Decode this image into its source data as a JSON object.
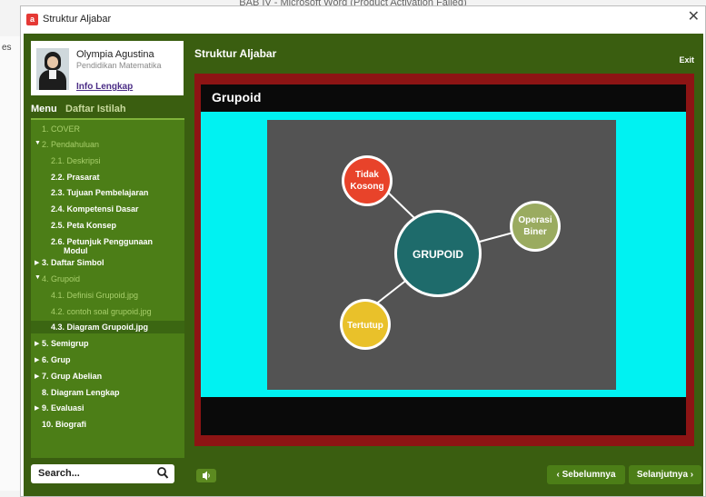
{
  "background_window": {
    "title": "BAB IV - Microsoft Word (Product Activation Failed)",
    "side_text": "es"
  },
  "window": {
    "title": "Struktur Aljabar",
    "icon": "presentation-app-icon",
    "close_icon": "close-icon"
  },
  "profile": {
    "name": "Olympia Agustina",
    "role": "Pendidikan Matematika",
    "link": "Info Lengkap"
  },
  "tabs": {
    "menu": "Menu",
    "glossary": "Daftar Istilah"
  },
  "menu": {
    "items": [
      {
        "label": "1. COVER",
        "arrow": ""
      },
      {
        "label": "2. Pendahuluan",
        "arrow": "▼"
      },
      {
        "label": "2.1. Deskripsi",
        "arrow": ""
      },
      {
        "label": "2.2. Prasarat",
        "arrow": ""
      },
      {
        "label": "2.3. Tujuan Pembelajaran",
        "arrow": ""
      },
      {
        "label": "2.4. Kompetensi Dasar",
        "arrow": ""
      },
      {
        "label": "2.5. Peta Konsep",
        "arrow": ""
      },
      {
        "label": "2.6. Petunjuk Penggunaan",
        "arrow": ""
      },
      {
        "label": "Modul",
        "arrow": ""
      },
      {
        "label": "3. Daftar Simbol",
        "arrow": "▶"
      },
      {
        "label": "4. Grupoid",
        "arrow": "▼"
      },
      {
        "label": "4.1. Definisi Grupoid.jpg",
        "arrow": ""
      },
      {
        "label": "4.2. contoh soal grupoid.jpg",
        "arrow": ""
      },
      {
        "label": "4.3. Diagram Grupoid.jpg",
        "arrow": ""
      },
      {
        "label": "5. Semigrup",
        "arrow": "▶"
      },
      {
        "label": "6. Grup",
        "arrow": "▶"
      },
      {
        "label": "7. Grup Abelian",
        "arrow": "▶"
      },
      {
        "label": "8. Diagram Lengkap",
        "arrow": ""
      },
      {
        "label": "9. Evaluasi",
        "arrow": "▶"
      },
      {
        "label": "10. Biografi",
        "arrow": ""
      }
    ]
  },
  "search": {
    "placeholder": "Search...",
    "icon": "search-icon"
  },
  "header": {
    "title": "Struktur Aljabar",
    "exit": "Exit"
  },
  "slide": {
    "title": "Grupoid",
    "diagram": {
      "center": {
        "label": "GRUPOID",
        "color": "#1e6b6b"
      },
      "nodes": [
        {
          "line1": "Tidak",
          "line2": "Kosong",
          "color": "#e8432a"
        },
        {
          "line1": "Operasi",
          "line2": "Biner",
          "color": "#9aab60"
        },
        {
          "line1": "Tertutup",
          "line2": "",
          "color": "#e9c12a"
        }
      ]
    }
  },
  "nav": {
    "prev": "‹ Sebelumnya",
    "next": "Selanjutnya ›",
    "volume_icon": "speaker-icon"
  },
  "colors": {
    "app_bg": "#3a5e10",
    "panel": "#4c7e17",
    "frame": "#8d1414",
    "cyan": "#00f2f2"
  }
}
